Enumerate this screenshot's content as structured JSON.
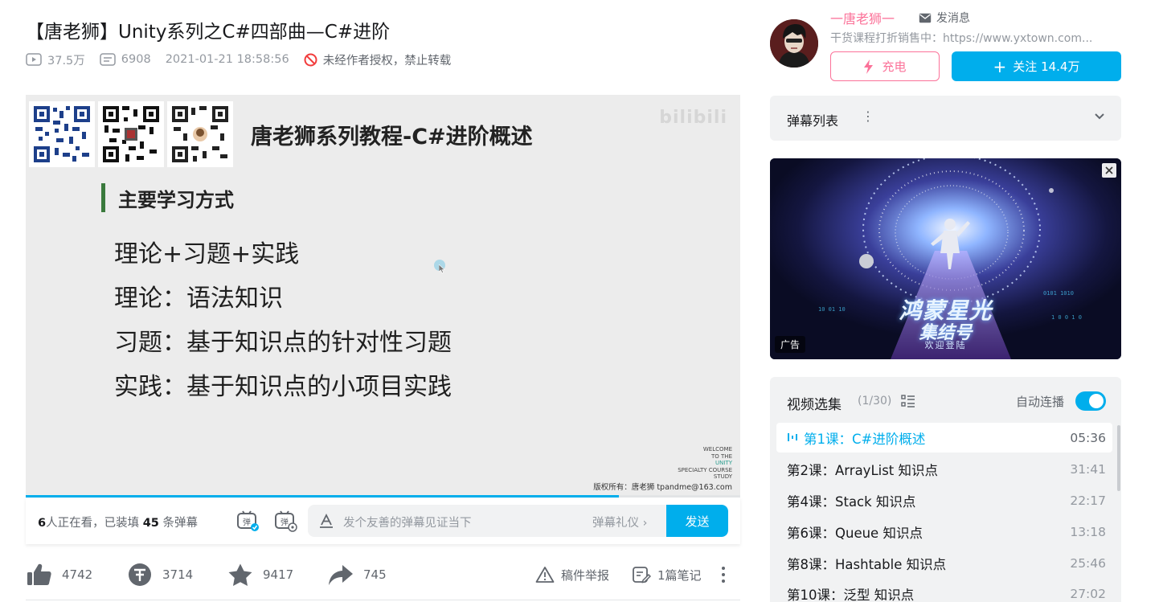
{
  "video": {
    "title": "【唐老狮】Unity系列之C#四部曲—C#进阶",
    "views": "37.5万",
    "danmaku_count": "6908",
    "pubdate": "2021-01-21 18:58:56",
    "copyright_notice": "未经作者授权，禁止转载"
  },
  "slide": {
    "title": "唐老狮系列教程-C#进阶概述",
    "watermark": "bilibili",
    "section": "主要学习方式",
    "lines": [
      "理论+习题+实践",
      "理论：语法知识",
      "习题：基于知识点的针对性习题",
      "实践：基于知识点的小项目实践"
    ],
    "welcome": [
      "WELCOME",
      "TO THE",
      "UNITY",
      "SPECIALTY COURSE",
      "STUDY"
    ],
    "copyright": "版权所有：唐老狮 tpandme@163.com",
    "progress": 0.83
  },
  "danmaku_bar": {
    "viewers_num": "6",
    "viewers_text": "人正在看，已装填 ",
    "loaded_num": "45",
    "loaded_text": " 条弹幕",
    "placeholder": "发个友善的弹幕见证当下",
    "etiquette": "弹幕礼仪 ›",
    "send_label": "发送"
  },
  "actions": {
    "likes": "4742",
    "coins": "3714",
    "favorites": "9417",
    "shares": "745",
    "report": "稿件举报",
    "notes": "1篇笔记"
  },
  "uploader": {
    "name": "一唐老狮一",
    "message_label": "发消息",
    "description": "干货课程打折销售中：https://www.yxtown.com...",
    "charge_label": "充电",
    "follow_label": "关注 14.4万"
  },
  "danmaku_list": {
    "label": "弹幕列表"
  },
  "ad": {
    "title_line1": "鸿蒙星光",
    "title_line2": "集结号",
    "subtitle": "欢迎登陆",
    "tag": "广告"
  },
  "playlist": {
    "title": "视频选集",
    "count": "(1/30)",
    "autoplay_label": "自动连播",
    "autoplay_on": true,
    "episodes": [
      {
        "title": "第1课：C#进阶概述",
        "duration": "05:36",
        "active": true
      },
      {
        "title": "第2课：ArrayList 知识点",
        "duration": "31:41"
      },
      {
        "title": "第4课：Stack 知识点",
        "duration": "22:17"
      },
      {
        "title": "第6课：Queue 知识点",
        "duration": "13:18"
      },
      {
        "title": "第8课：Hashtable 知识点",
        "duration": "25:46"
      },
      {
        "title": "第10课：泛型 知识点",
        "duration": "27:02"
      }
    ]
  },
  "colors": {
    "accent": "#00aeec",
    "pink": "#fb7299",
    "muted": "#9499a0"
  }
}
